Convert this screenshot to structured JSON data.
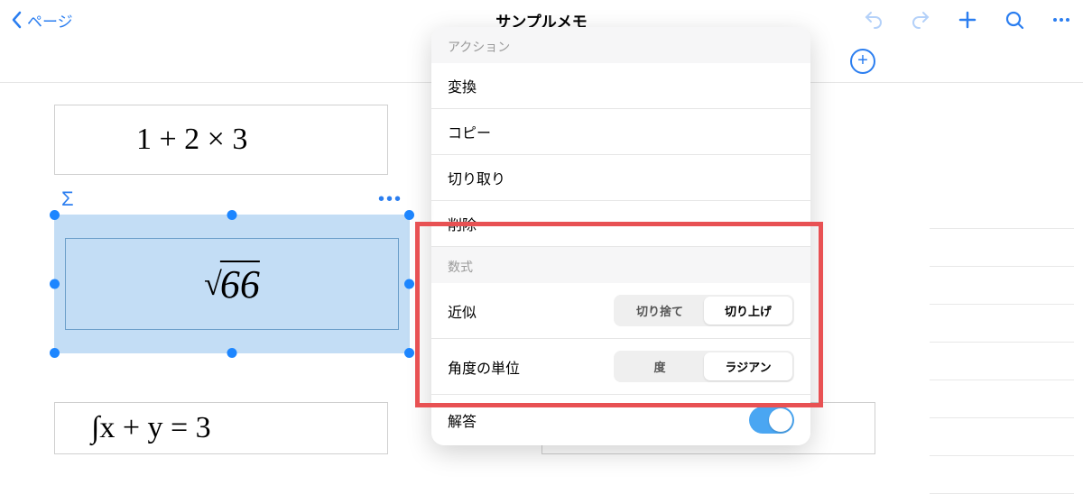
{
  "header": {
    "back_label": "ページ",
    "title": "サンプルメモ"
  },
  "canvas": {
    "expr1": "1 + 2 × 3",
    "expr2_root": "√",
    "expr2_val": "66",
    "sigma": "Σ",
    "expr3_hand": "∫x + y = 3",
    "expr3_typeset": "∫ x + y = 3"
  },
  "popover": {
    "section_action": "アクション",
    "convert": "変換",
    "copy": "コピー",
    "cut": "切り取り",
    "delete": "削除",
    "section_math": "数式",
    "approx_label": "近似",
    "approx_options": {
      "opt1": "切り捨て",
      "opt2": "切り上げ"
    },
    "angle_label": "角度の単位",
    "angle_options": {
      "opt1": "度",
      "opt2": "ラジアン"
    },
    "answer_label": "解答"
  }
}
